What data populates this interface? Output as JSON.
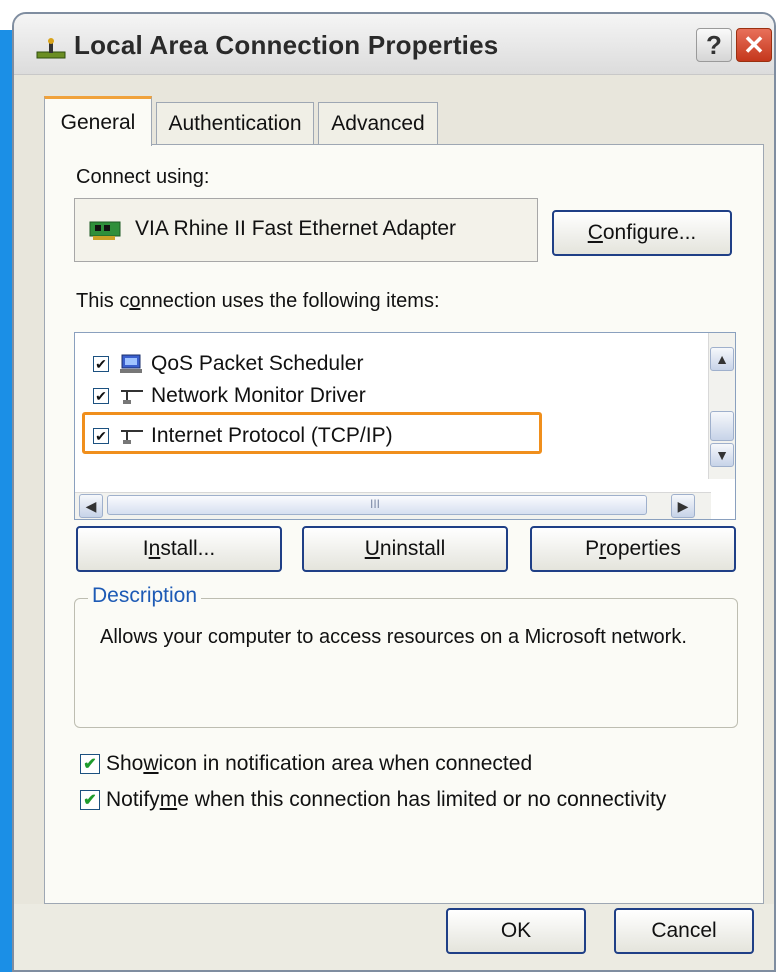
{
  "window": {
    "title": "Local Area Connection Properties",
    "help_label": "?",
    "close_label": "✕"
  },
  "tabs": [
    {
      "label": "General",
      "selected": true
    },
    {
      "label": "Authentication",
      "selected": false
    },
    {
      "label": "Advanced",
      "selected": false
    }
  ],
  "connect_using": {
    "label": "Connect using:",
    "adapter": "VIA Rhine II Fast Ethernet Adapter",
    "configure_prefix": "",
    "configure_u": "C",
    "configure_rest": "onfigure..."
  },
  "items": {
    "label_pre": "This c",
    "label_u": "o",
    "label_post": "nnection uses the following items:",
    "rows": [
      {
        "label": "QoS Packet Scheduler",
        "checked": true,
        "icon": "scheduler-icon"
      },
      {
        "label": "Network Monitor Driver",
        "checked": true,
        "icon": "network-protocol-icon"
      },
      {
        "label": "Internet Protocol (TCP/IP)",
        "checked": true,
        "icon": "network-protocol-icon",
        "highlighted": true
      }
    ],
    "hscroll_grip": "III"
  },
  "buttons": {
    "install_pre": "I",
    "install_u": "n",
    "install_post": "stall...",
    "uninstall_pre": "",
    "uninstall_u": "U",
    "uninstall_post": "ninstall",
    "properties_pre": "P",
    "properties_u": "r",
    "properties_post": "operties",
    "ok": "OK",
    "cancel": "Cancel"
  },
  "description": {
    "legend": "Description",
    "text": "Allows your computer to access resources on a Microsoft network."
  },
  "options": {
    "show_icon_pre": "Sho",
    "show_icon_u": "w",
    "show_icon_post": " icon in notification area when connected",
    "show_icon_checked": true,
    "notify_pre": "Notify ",
    "notify_u": "m",
    "notify_post": "e when this connection has limited or no connectivity",
    "notify_checked": true
  },
  "colors": {
    "highlight": "#f08f1c",
    "accent_blue": "#1b8fe6",
    "description_legend": "#1d5ab5"
  }
}
